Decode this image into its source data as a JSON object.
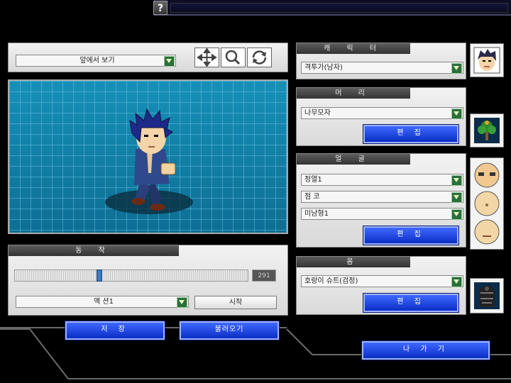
{
  "topbar": {
    "help_label": "?"
  },
  "view": {
    "mode_label": "앞에서    보기"
  },
  "tools": {
    "move": "move-icon",
    "zoom": "magnify-icon",
    "rotate": "rotate-icon"
  },
  "action": {
    "title": "동  작",
    "frame_counter": "291",
    "slider_value": 0.36,
    "action_select": "액  션1",
    "start_label": "시작"
  },
  "buttons": {
    "save": "저  장",
    "load": "불러오기",
    "exit": "나 가 기"
  },
  "character": {
    "title": "캐 릭 터",
    "select": "격투가(남자)"
  },
  "hair": {
    "title": "머  리",
    "select": "나무모자",
    "edit": "편  집"
  },
  "face": {
    "title": "얼  굴",
    "eyes": "정열1",
    "nose": "점 코",
    "mouth": "미남형1",
    "edit": "편  집"
  },
  "body": {
    "title": "몸",
    "select": "호랑이 슈트(검정)",
    "edit": "편  집"
  },
  "colors": {
    "accent_blue": "#1f44e0",
    "grid_bg": "#1c8cb0",
    "panel_bg": "#e2e2e2"
  }
}
